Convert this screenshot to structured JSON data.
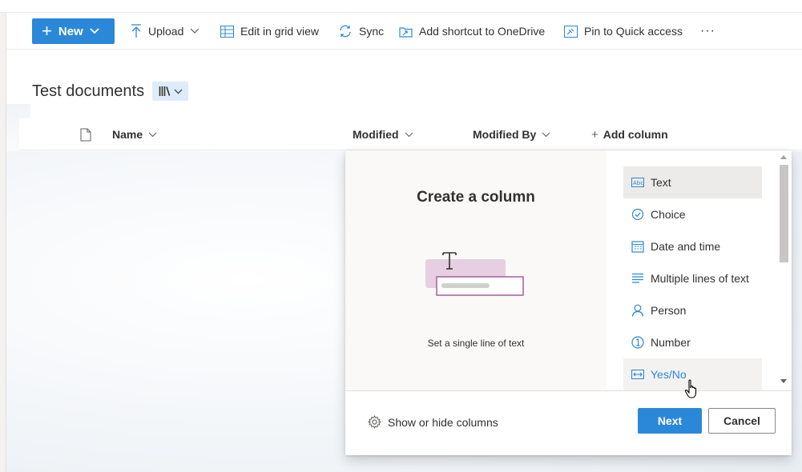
{
  "command_bar": {
    "new_label": "New",
    "upload_label": "Upload",
    "edit_grid_label": "Edit in grid view",
    "sync_label": "Sync",
    "add_shortcut_label": "Add shortcut to OneDrive",
    "pin_label": "Pin to Quick access",
    "more_label": "···"
  },
  "library": {
    "title": "Test documents"
  },
  "columns": {
    "name": "Name",
    "modified": "Modified",
    "modified_by": "Modified By",
    "add_column": "Add column"
  },
  "create_column_panel": {
    "heading": "Create a column",
    "description": "Set a single line of text",
    "types": [
      {
        "label": "Text",
        "icon": "text-abc-icon"
      },
      {
        "label": "Choice",
        "icon": "choice-check-icon"
      },
      {
        "label": "Date and time",
        "icon": "calendar-icon"
      },
      {
        "label": "Multiple lines of text",
        "icon": "multiline-text-icon"
      },
      {
        "label": "Person",
        "icon": "person-icon"
      },
      {
        "label": "Number",
        "icon": "number-icon"
      },
      {
        "label": "Yes/No",
        "icon": "yes-no-toggle-icon"
      }
    ],
    "selected_type": "Text",
    "show_hide_label": "Show or hide columns",
    "next_label": "Next",
    "cancel_label": "Cancel"
  },
  "colors": {
    "accent": "#2b88d8",
    "selected_bg": "#edebe9",
    "view_button_bg": "#deecf9"
  }
}
